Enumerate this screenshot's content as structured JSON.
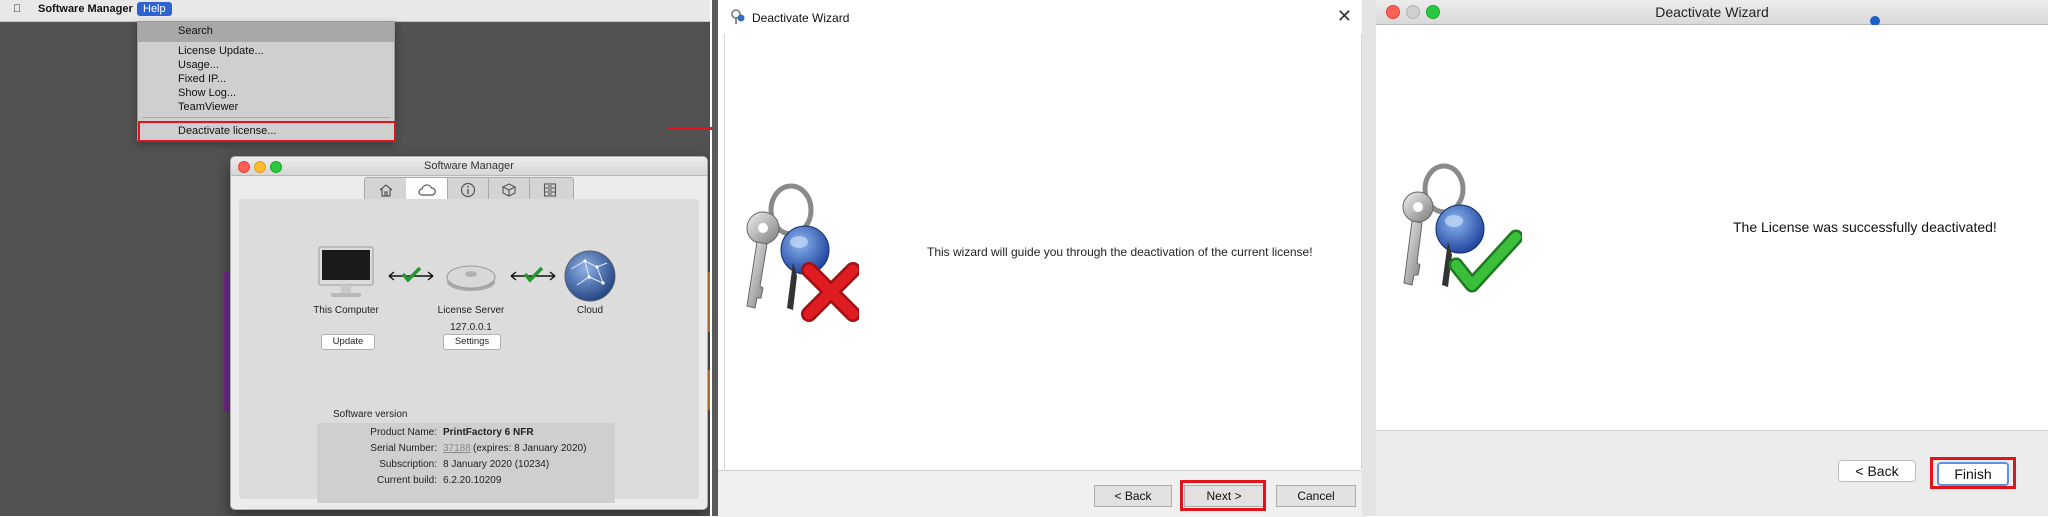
{
  "panel1": {
    "menubar": {
      "app_name": "Software Manager",
      "help_label": "Help"
    },
    "help_menu": {
      "search_label": "Search",
      "items": [
        "License Update...",
        "Usage...",
        "Fixed IP...",
        "Show Log...",
        "TeamViewer"
      ],
      "deactivate_label": "Deactivate license..."
    },
    "window": {
      "title": "Software Manager",
      "nodes": {
        "computer_label": "This Computer",
        "server_label": "License Server",
        "server_ip": "127.0.0.1",
        "cloud_label": "Cloud"
      },
      "update_button": "Update",
      "settings_button": "Settings",
      "software_version_label": "Software version",
      "info": [
        {
          "key": "Product Name:",
          "value": "PrintFactory 6 NFR"
        },
        {
          "key": "Serial Number:",
          "value": "37188",
          "suffix": "(expires: 8 January 2020)"
        },
        {
          "key": "Subscription:",
          "value": "8 January 2020 (10234)"
        },
        {
          "key": "Current build:",
          "value": "6.2.20.10209"
        }
      ]
    }
  },
  "panel2": {
    "title": "Deactivate Wizard",
    "message": "This wizard will guide you through the deactivation of the current license!",
    "back_button": "< Back",
    "next_button": "Next >",
    "cancel_button": "Cancel"
  },
  "panel3": {
    "title": "Deactivate Wizard",
    "message": "The License was successfully deactivated!",
    "back_button": "< Back",
    "finish_button": "Finish"
  },
  "colors": {
    "highlight": "#e3121b",
    "menu_selected": "#2e63d3"
  }
}
